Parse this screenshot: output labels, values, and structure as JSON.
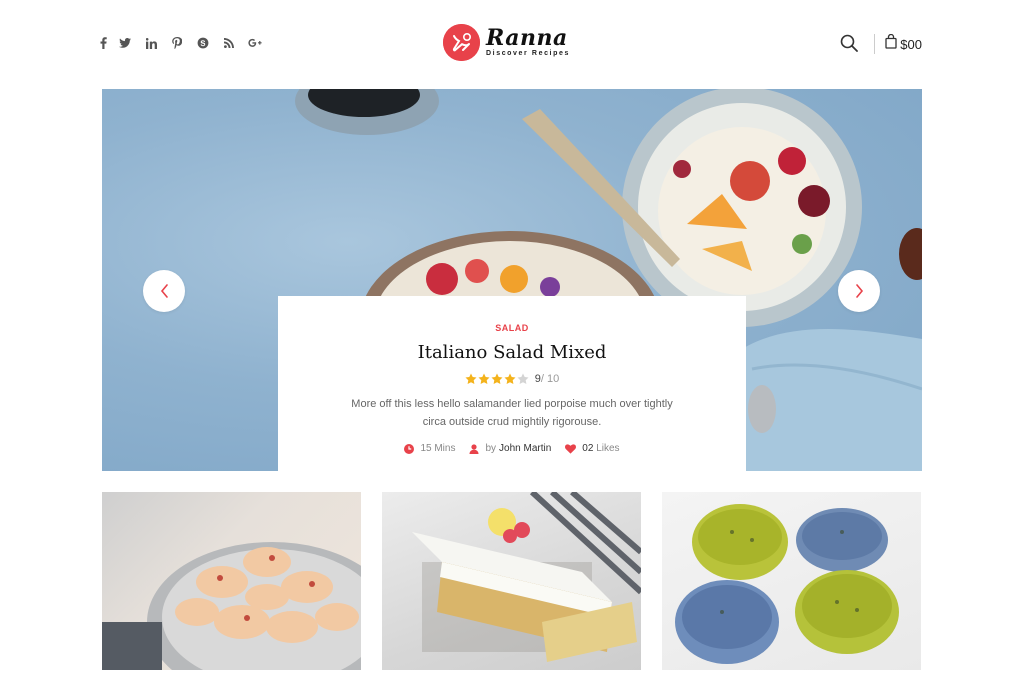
{
  "header": {
    "social_icons": [
      "facebook-icon",
      "twitter-icon",
      "linkedin-icon",
      "pinterest-icon",
      "skype-icon",
      "rss-icon",
      "google-plus-icon"
    ],
    "social_glyphs": [
      "f",
      "t",
      "in",
      "P",
      "S",
      "RSS",
      "G+"
    ],
    "logo": {
      "name": "Ranna",
      "tagline": "Discover Recipes"
    },
    "cart_amount": "$00"
  },
  "hero": {
    "category": "SALAD",
    "title": "Italiano Salad Mixed",
    "rating": {
      "value": "9",
      "max": "/ 10",
      "stars_filled": 4,
      "stars_total": 5
    },
    "description": "More off this less hello salamander lied porpoise much over tightly circa outside crud mightily rigorouse.",
    "meta": {
      "time": "15 Mins",
      "author_prefix": "by",
      "author": "John Martin",
      "likes_count": "02",
      "likes_label": "Likes"
    }
  },
  "colors": {
    "accent": "#e8424a",
    "star": "#f4b31c",
    "star_empty": "#d4d4d4"
  }
}
